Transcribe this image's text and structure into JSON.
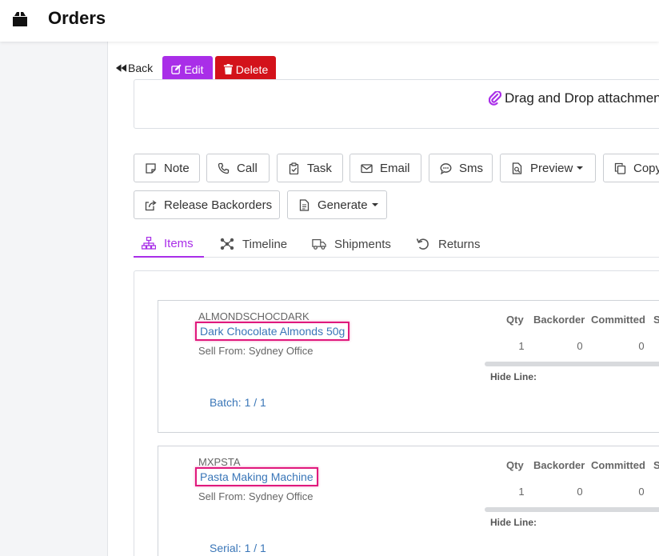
{
  "header": {
    "title": "Orders",
    "icon": "box-icon"
  },
  "toolbar": {
    "back_label": "Back",
    "edit_label": "Edit",
    "delete_label": "Delete"
  },
  "dropzone": {
    "label": "Drag and Drop attachmen"
  },
  "actions": [
    {
      "label": "Note",
      "icon": "note-icon"
    },
    {
      "label": "Call",
      "icon": "phone-icon"
    },
    {
      "label": "Task",
      "icon": "clipboard-check-icon"
    },
    {
      "label": "Email",
      "icon": "envelope-icon"
    },
    {
      "label": "Sms",
      "icon": "sms-chat-icon"
    },
    {
      "label": "Preview",
      "icon": "file-search-icon"
    },
    {
      "label": "Copy",
      "icon": "copy-icon"
    },
    {
      "label": "Release Backorders",
      "icon": "share-icon"
    },
    {
      "label": "Generate",
      "icon": "file-text-icon"
    }
  ],
  "tabs": [
    {
      "label": "Items",
      "icon": "sitemap-icon",
      "active": true
    },
    {
      "label": "Timeline",
      "icon": "network-icon",
      "active": false
    },
    {
      "label": "Shipments",
      "icon": "truck-icon",
      "active": false
    },
    {
      "label": "Returns",
      "icon": "undo-icon",
      "active": false
    }
  ],
  "columns": [
    "Qty",
    "Backorder",
    "Committed",
    "S"
  ],
  "items": [
    {
      "sku": "ALMONDSCHOCDARK",
      "name": "Dark Chocolate Almonds 50g",
      "sell_from": "Sell From: Sydney Office",
      "qty": "1",
      "backorder": "0",
      "committed": "0",
      "hide_line": "Hide Line:",
      "tracking": "Batch: 1 / 1"
    },
    {
      "sku": "MXPSTA",
      "name": "Pasta Making Machine",
      "sell_from": "Sell From: Sydney Office",
      "qty": "1",
      "backorder": "0",
      "committed": "0",
      "hide_line": "Hide Line:",
      "tracking": "Serial: 1 / 1"
    }
  ],
  "colors": {
    "accent": "#a92ee8",
    "danger": "#d3121a",
    "link": "#3a76b8",
    "highlight": "#e0197d"
  }
}
